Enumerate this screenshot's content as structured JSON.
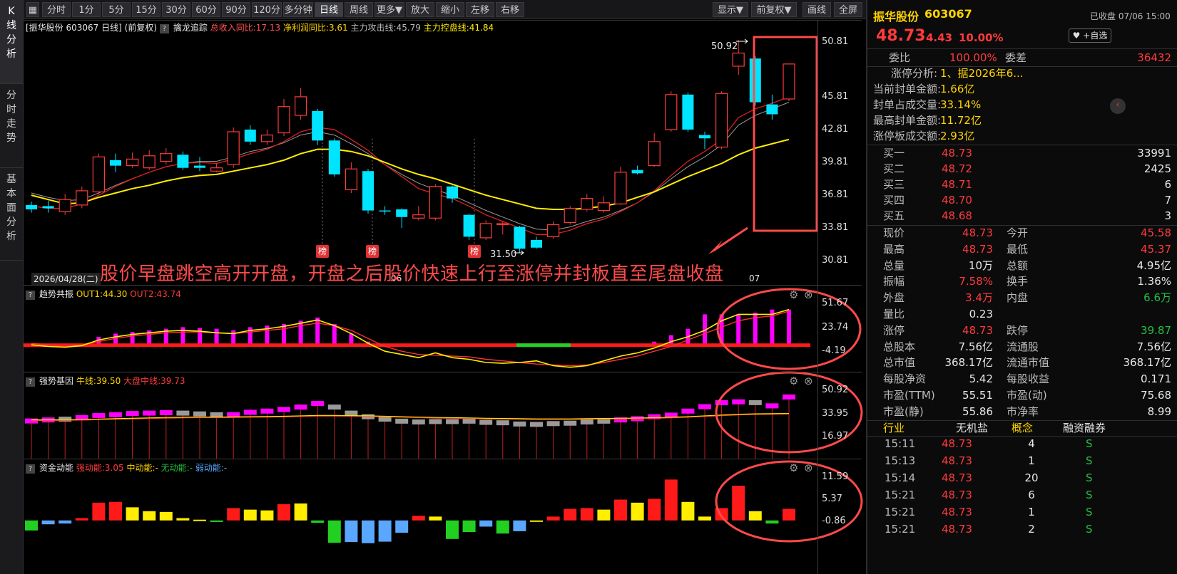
{
  "left_tabs": [
    "K线分析",
    "分时走势",
    "基本面分析"
  ],
  "toolbar": {
    "buttons": [
      "分时",
      "1分",
      "5分",
      "15分",
      "30分",
      "60分",
      "90分",
      "120分",
      "多分钟",
      "日线",
      "周线",
      "更多▼",
      "放大",
      "缩小",
      "左移",
      "右移"
    ],
    "right_buttons": [
      "显示▼",
      "前复权▼",
      "画线",
      "全屏"
    ]
  },
  "chart_info": {
    "title": "[振华股份 603067 日线]",
    "adjust": "(前复权)",
    "indicator": "擒龙追踪",
    "revenue": "总收入同比:17.13",
    "profit": "净利润同比:3.61",
    "attack": "主力攻击线:45.79",
    "control": "主力控盘线:41.84"
  },
  "main_chart": {
    "y_ticks": [
      "50.81",
      "45.81",
      "42.81",
      "39.81",
      "36.81",
      "33.81",
      "30.81"
    ],
    "high_label": "50.92",
    "low_label": "31.50",
    "badge": "榜",
    "date_label": "2026/04/28(二)",
    "x_labels": [
      "06",
      "07"
    ],
    "annotation": "股价早盘跳空高开开盘，开盘之后股价快速上行至涨停并封板直至尾盘收盘"
  },
  "panel1": {
    "name": "趋势共振",
    "out1": "OUT1:44.30",
    "out2": "OUT2:43.74",
    "y_ticks": [
      "51.67",
      "23.74",
      "-4.19"
    ]
  },
  "panel2": {
    "name": "强势基因",
    "bull": "牛线:39.50",
    "mid": "大盘中线:39.73",
    "y_ticks": [
      "50.92",
      "33.95",
      "16.97"
    ]
  },
  "panel3": {
    "name": "资金动能",
    "strong": "强动能:3.05",
    "medium": "中动能:-",
    "none": "无动能:-",
    "weak": "弱动能:-",
    "y_ticks": [
      "11.59",
      "5.37",
      "-0.86"
    ]
  },
  "colors": {
    "up": "#ff3b3b",
    "down": "#00e5ff",
    "ma_yellow": "#ffee00",
    "magenta": "#ff00ff",
    "annotation": "#ff4a4a"
  },
  "chart_data": {
    "type": "candlestick",
    "title": "振华股份 603067 日线",
    "ylim": [
      30.81,
      50.81
    ],
    "candles": [
      [
        35.5,
        35.9,
        35.2,
        36.2,
        "d"
      ],
      [
        35.6,
        35.8,
        35.2,
        36.3,
        "d"
      ],
      [
        35.3,
        36.4,
        35.0,
        36.9,
        "u"
      ],
      [
        35.9,
        37.2,
        35.6,
        37.6,
        "u"
      ],
      [
        37.1,
        40.3,
        36.9,
        40.6,
        "u"
      ],
      [
        40.0,
        39.5,
        38.9,
        40.6,
        "d"
      ],
      [
        39.5,
        40.1,
        39.3,
        40.7,
        "u"
      ],
      [
        39.3,
        40.4,
        39.1,
        40.9,
        "u"
      ],
      [
        39.9,
        40.6,
        39.6,
        41.1,
        "u"
      ],
      [
        40.5,
        39.3,
        39.1,
        40.8,
        "d"
      ],
      [
        39.5,
        39.3,
        39.0,
        40.3,
        "d"
      ],
      [
        39.0,
        39.3,
        38.9,
        39.7,
        "u"
      ],
      [
        39.6,
        42.6,
        39.3,
        43.0,
        "u"
      ],
      [
        42.8,
        41.7,
        41.4,
        43.2,
        "d"
      ],
      [
        41.7,
        42.3,
        41.4,
        42.8,
        "u"
      ],
      [
        42.5,
        44.9,
        42.2,
        45.6,
        "u"
      ],
      [
        44.1,
        45.8,
        43.7,
        46.6,
        "u"
      ],
      [
        44.5,
        41.8,
        41.4,
        44.7,
        "d"
      ],
      [
        41.8,
        38.7,
        38.5,
        42.0,
        "d"
      ],
      [
        37.3,
        39.2,
        37.0,
        39.8,
        "u"
      ],
      [
        39.0,
        35.4,
        35.1,
        39.2,
        "d"
      ],
      [
        35.4,
        35.4,
        35.0,
        35.8,
        "d"
      ],
      [
        35.5,
        34.8,
        33.8,
        35.6,
        "d"
      ],
      [
        34.7,
        35.0,
        34.5,
        35.8,
        "u"
      ],
      [
        34.7,
        37.6,
        34.5,
        37.8,
        "u"
      ],
      [
        37.6,
        36.5,
        36.1,
        37.7,
        "d"
      ],
      [
        35.0,
        33.0,
        32.7,
        35.1,
        "d"
      ],
      [
        32.9,
        34.2,
        32.7,
        34.5,
        "u"
      ],
      [
        34.1,
        34.2,
        33.2,
        34.4,
        "u"
      ],
      [
        33.9,
        31.9,
        31.5,
        34.0,
        "d"
      ],
      [
        32.7,
        32.0,
        31.9,
        33.0,
        "d"
      ],
      [
        33.0,
        34.1,
        32.8,
        34.4,
        "u"
      ],
      [
        34.3,
        35.6,
        34.1,
        35.8,
        "u"
      ],
      [
        35.5,
        36.5,
        35.3,
        36.9,
        "u"
      ],
      [
        35.4,
        36.1,
        35.2,
        36.7,
        "u"
      ],
      [
        36.0,
        38.9,
        35.9,
        39.4,
        "u"
      ],
      [
        39.1,
        38.8,
        38.7,
        39.5,
        "d"
      ],
      [
        39.5,
        41.7,
        39.4,
        42.5,
        "u"
      ],
      [
        42.8,
        46.0,
        42.6,
        46.3,
        "u"
      ],
      [
        46.0,
        42.8,
        42.6,
        46.2,
        "d"
      ],
      [
        42.3,
        42.0,
        41.0,
        42.6,
        "d"
      ],
      [
        41.2,
        46.1,
        41.0,
        46.3,
        "u"
      ],
      [
        48.6,
        49.8,
        47.8,
        51.0,
        "u"
      ],
      [
        49.3,
        45.3,
        45.0,
        49.5,
        "d"
      ],
      [
        45.1,
        44.2,
        43.7,
        46.0,
        "d"
      ],
      [
        45.6,
        48.8,
        45.4,
        48.8,
        "u"
      ]
    ],
    "ma_yellow": [
      36.8,
      36.4,
      36.0,
      36.1,
      36.6,
      37.0,
      37.4,
      37.7,
      38.1,
      38.4,
      38.6,
      38.7,
      39.0,
      39.3,
      39.6,
      40.0,
      40.6,
      41.0,
      41.0,
      40.8,
      40.4,
      39.8,
      39.2,
      38.7,
      38.3,
      37.8,
      37.3,
      36.8,
      36.4,
      36.0,
      35.6,
      35.5,
      35.5,
      35.6,
      35.8,
      36.1,
      36.6,
      37.1,
      37.8,
      38.5,
      39.1,
      39.7,
      40.5,
      41.1,
      41.5,
      41.9
    ],
    "ma_red": [
      35.8,
      35.6,
      35.6,
      36.0,
      36.8,
      37.6,
      38.3,
      38.9,
      39.4,
      39.7,
      39.8,
      39.7,
      40.1,
      40.6,
      41.0,
      41.7,
      42.6,
      43.0,
      42.8,
      41.9,
      40.9,
      39.6,
      38.5,
      37.4,
      36.9,
      36.5,
      35.8,
      35.0,
      34.4,
      33.8,
      33.2,
      33.2,
      33.6,
      34.2,
      34.6,
      35.3,
      36.1,
      37.2,
      38.6,
      39.9,
      40.8,
      41.9,
      43.9,
      44.7,
      45.2,
      45.8
    ],
    "ma_gray": [
      37.0,
      36.6,
      36.3,
      36.4,
      37.0,
      37.7,
      38.3,
      38.9,
      39.4,
      39.7,
      39.9,
      39.9,
      40.3,
      40.8,
      41.1,
      41.6,
      42.3,
      42.6,
      42.3,
      41.5,
      40.6,
      39.6,
      38.7,
      37.9,
      37.3,
      36.8,
      36.1,
      35.4,
      34.8,
      34.2,
      33.7,
      33.6,
      33.9,
      34.4,
      34.8,
      35.4,
      36.1,
      37.1,
      38.3,
      39.4,
      40.3,
      41.4,
      43.2,
      44.1,
      44.7,
      45.3
    ]
  },
  "panel1_data": {
    "bars": [
      0,
      0,
      0,
      0,
      10,
      14,
      16,
      18,
      20,
      22,
      21,
      20,
      18,
      22,
      24,
      26,
      30,
      34,
      26,
      14,
      4,
      0,
      0,
      0,
      0,
      0,
      0,
      0,
      0,
      0,
      0,
      0,
      0,
      0,
      0,
      0,
      0,
      4,
      12,
      20,
      38,
      38,
      38,
      40,
      44,
      44,
      42,
      42,
      42,
      42
    ],
    "line_yellow": [
      0,
      -2,
      -3,
      -1,
      6,
      10,
      13,
      15,
      17,
      18,
      17,
      15,
      14,
      18,
      20,
      23,
      27,
      31,
      24,
      14,
      2,
      -8,
      -12,
      -16,
      -10,
      -16,
      -18,
      -22,
      -23,
      -22,
      -20,
      -26,
      -28,
      -26,
      -20,
      -14,
      -10,
      -4,
      4,
      10,
      18,
      30,
      38,
      38,
      38,
      44,
      48,
      45,
      40,
      44
    ],
    "line_red": [
      2,
      0,
      -2,
      0,
      4,
      8,
      11,
      13,
      15,
      16,
      16,
      15,
      14,
      16,
      18,
      20,
      24,
      27,
      24,
      18,
      8,
      -2,
      -8,
      -12,
      -13,
      -14,
      -15,
      -18,
      -20,
      -22,
      -24,
      -25,
      -26,
      -25,
      -22,
      -18,
      -14,
      -8,
      -2,
      6,
      14,
      22,
      30,
      34,
      36,
      42,
      46,
      45,
      42,
      40
    ]
  },
  "panel2_data": {
    "blocks": [
      [
        35.5,
        "u"
      ],
      [
        36,
        "u"
      ],
      [
        36.4,
        "g"
      ],
      [
        37.2,
        "u"
      ],
      [
        38.2,
        "u"
      ],
      [
        38.6,
        "u"
      ],
      [
        39.2,
        "u"
      ],
      [
        39.4,
        "u"
      ],
      [
        39.6,
        "u"
      ],
      [
        39.4,
        "g"
      ],
      [
        39.0,
        "g"
      ],
      [
        38.6,
        "g"
      ],
      [
        38.6,
        "u"
      ],
      [
        39.8,
        "u"
      ],
      [
        40.4,
        "u"
      ],
      [
        41.2,
        "u"
      ],
      [
        42.4,
        "u"
      ],
      [
        44.2,
        "u"
      ],
      [
        42.4,
        "g"
      ],
      [
        39.4,
        "g"
      ],
      [
        37.6,
        "g"
      ],
      [
        36.4,
        "g"
      ],
      [
        35.4,
        "g"
      ],
      [
        35.0,
        "g"
      ],
      [
        35.2,
        "g"
      ],
      [
        35.2,
        "g"
      ],
      [
        35.4,
        "g"
      ],
      [
        34.8,
        "g"
      ],
      [
        34.6,
        "g"
      ],
      [
        34.0,
        "g"
      ],
      [
        33.8,
        "g"
      ],
      [
        34.2,
        "g"
      ],
      [
        34.4,
        "g"
      ],
      [
        35.0,
        "g"
      ],
      [
        35.4,
        "g"
      ],
      [
        36.0,
        "u"
      ],
      [
        36.6,
        "u"
      ],
      [
        37.6,
        "u"
      ],
      [
        38.4,
        "u"
      ],
      [
        40.4,
        "u"
      ],
      [
        42.6,
        "u"
      ],
      [
        44.6,
        "u"
      ],
      [
        45.0,
        "u"
      ],
      [
        44.6,
        "g"
      ],
      [
        43.0,
        "u"
      ],
      [
        47.4,
        "u"
      ],
      [
        49.2,
        "u"
      ],
      [
        47.0,
        "u"
      ],
      [
        46.8,
        "u"
      ],
      [
        47.6,
        "u"
      ]
    ],
    "line": [
      36.2,
      36.2,
      36.3,
      36.4,
      36.6,
      36.8,
      37.0,
      37.2,
      37.4,
      37.5,
      37.6,
      37.6,
      37.7,
      37.8,
      37.9,
      38.0,
      38.2,
      38.4,
      38.4,
      38.3,
      38.2,
      38.0,
      37.8,
      37.6,
      37.4,
      37.3,
      37.2,
      37.0,
      36.9,
      36.8,
      36.7,
      36.7,
      36.7,
      36.8,
      36.9,
      37.0,
      37.1,
      37.3,
      37.5,
      37.8,
      38.2,
      38.6,
      39.0,
      39.2,
      39.3,
      39.4,
      39.5,
      39.5,
      39.5,
      39.5
    ]
  },
  "panel3_data": {
    "bars": [
      [
        -2.6,
        "g"
      ],
      [
        -1.0,
        "b"
      ],
      [
        -0.8,
        "b"
      ],
      [
        0.6,
        "r"
      ],
      [
        4.6,
        "r"
      ],
      [
        4.8,
        "r"
      ],
      [
        3.4,
        "y"
      ],
      [
        2.4,
        "y"
      ],
      [
        2.2,
        "y"
      ],
      [
        0.6,
        "y"
      ],
      [
        0.2,
        "y"
      ],
      [
        -0.4,
        "g"
      ],
      [
        3.2,
        "r"
      ],
      [
        2.8,
        "y"
      ],
      [
        2.6,
        "y"
      ],
      [
        4.2,
        "r"
      ],
      [
        4.4,
        "y"
      ],
      [
        -0.6,
        "g"
      ],
      [
        -5.8,
        "g"
      ],
      [
        -5.6,
        "b"
      ],
      [
        -5.9,
        "b"
      ],
      [
        -5.5,
        "b"
      ],
      [
        -3.2,
        "b"
      ],
      [
        1.2,
        "r"
      ],
      [
        1.0,
        "y"
      ],
      [
        -4.8,
        "g"
      ],
      [
        -3.0,
        "g"
      ],
      [
        -1.6,
        "b"
      ],
      [
        -3.4,
        "g"
      ],
      [
        -2.8,
        "b"
      ],
      [
        0,
        "y"
      ],
      [
        1.0,
        "r"
      ],
      [
        3.0,
        "r"
      ],
      [
        3.2,
        "r"
      ],
      [
        2.8,
        "y"
      ],
      [
        5.4,
        "r"
      ],
      [
        4.6,
        "y"
      ],
      [
        5.6,
        "r"
      ],
      [
        10.6,
        "r"
      ],
      [
        4.8,
        "y"
      ],
      [
        1.0,
        "y"
      ],
      [
        3.2,
        "r"
      ],
      [
        9.0,
        "r"
      ],
      [
        2.4,
        "y"
      ],
      [
        -0.8,
        "g"
      ],
      [
        3.0,
        "r"
      ]
    ]
  },
  "right_panel": {
    "stock_name": "振华股份",
    "stock_code": "603067",
    "status": "已收盘 07/06 15:00",
    "price": "48.73",
    "change": "4.43",
    "change_pct": "10.00%",
    "watch_button": "+自选",
    "weibi_label": "委比",
    "weibi": "100.00%",
    "weicha_label": "委差",
    "weicha": "36432",
    "limit_info": [
      [
        "涨停分析:",
        "1、据2026年6..."
      ],
      [
        "当前封单金额:",
        "1.66亿"
      ],
      [
        "封单占成交量:",
        "33.14%"
      ],
      [
        "最高封单金额:",
        "11.72亿"
      ],
      [
        "涨停板成交额:",
        "2.93亿"
      ]
    ],
    "bids": [
      [
        "买一",
        "48.73",
        "33991"
      ],
      [
        "买二",
        "48.72",
        "2425"
      ],
      [
        "买三",
        "48.71",
        "6"
      ],
      [
        "买四",
        "48.70",
        "7"
      ],
      [
        "买五",
        "48.68",
        "3"
      ]
    ],
    "stats": [
      [
        "现价",
        "48.73",
        "r",
        "今开",
        "45.58",
        "r"
      ],
      [
        "最高",
        "48.73",
        "r",
        "最低",
        "45.37",
        "r"
      ],
      [
        "总量",
        "10万",
        "w",
        "总额",
        "4.95亿",
        "w"
      ],
      [
        "振幅",
        "7.58%",
        "r",
        "换手",
        "1.36%",
        "w"
      ],
      [
        "外盘",
        "3.4万",
        "r",
        "内盘",
        "6.6万",
        "g"
      ],
      [
        "量比",
        "0.23",
        "w",
        "",
        "",
        " "
      ],
      [
        "涨停",
        "48.73",
        "r",
        "跌停",
        "39.87",
        "g"
      ],
      [
        "总股本",
        "7.56亿",
        "w",
        "流通股",
        "7.56亿",
        "w"
      ],
      [
        "总市值",
        "368.17亿",
        "w",
        "流通市值",
        "368.17亿",
        "w"
      ],
      [
        "每股净资",
        "5.42",
        "w",
        "每股收益",
        "0.171",
        "w"
      ],
      [
        "市盈(TTM)",
        "55.51",
        "w",
        "市盈(动)",
        "75.68",
        "w"
      ],
      [
        "市盈(静)",
        "55.86",
        "w",
        "市净率",
        "8.99",
        "w"
      ]
    ],
    "tags": [
      "行业",
      "无机盐",
      "概念",
      "融资融券"
    ],
    "ticks": [
      [
        "15:11",
        "48.73",
        "4",
        "S"
      ],
      [
        "15:13",
        "48.73",
        "1",
        "S"
      ],
      [
        "15:14",
        "48.73",
        "20",
        "S"
      ],
      [
        "15:21",
        "48.73",
        "6",
        "S"
      ],
      [
        "15:21",
        "48.73",
        "1",
        "S"
      ],
      [
        "15:21",
        "48.73",
        "2",
        "S"
      ]
    ]
  }
}
